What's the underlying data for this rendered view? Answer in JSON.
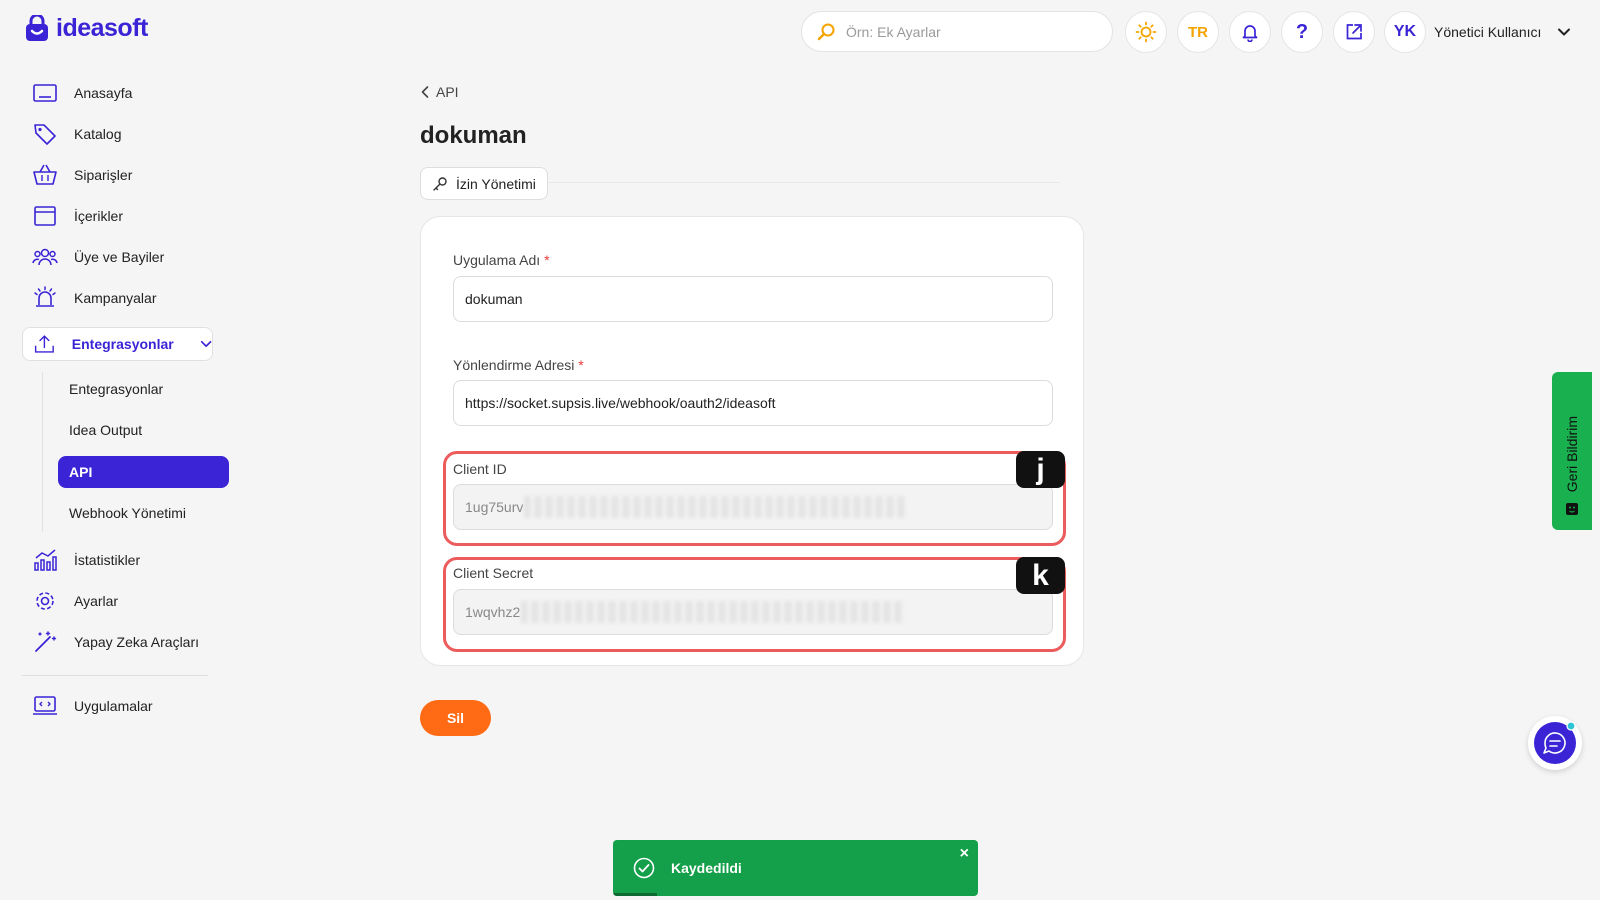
{
  "brand": {
    "name": "ideasoft",
    "color": "#3a24d6"
  },
  "header": {
    "search_placeholder": "Örn: Ek Ayarlar",
    "language": "TR",
    "help_label": "?",
    "user_initials": "YK",
    "user_name": "Yönetici Kullanıcı"
  },
  "sidebar": {
    "items": [
      {
        "label": "Anasayfa",
        "icon": "home-icon"
      },
      {
        "label": "Katalog",
        "icon": "tag-icon"
      },
      {
        "label": "Siparişler",
        "icon": "basket-icon"
      },
      {
        "label": "İçerikler",
        "icon": "window-icon"
      },
      {
        "label": "Üye ve Bayiler",
        "icon": "users-icon"
      },
      {
        "label": "Kampanyalar",
        "icon": "siren-icon"
      },
      {
        "label": "Entegrasyonlar",
        "icon": "upload-icon"
      },
      {
        "label": "İstatistikler",
        "icon": "stats-icon"
      },
      {
        "label": "Ayarlar",
        "icon": "gear-icon"
      },
      {
        "label": "Yapay Zeka Araçları",
        "icon": "magic-wand-icon"
      },
      {
        "label": "Uygulamalar",
        "icon": "app-icon"
      }
    ],
    "sub_items": [
      {
        "label": "Entegrasyonlar"
      },
      {
        "label": "Idea Output"
      },
      {
        "label": "API"
      },
      {
        "label": "Webhook Yönetimi"
      }
    ]
  },
  "main": {
    "breadcrumb": "API",
    "title": "dokuman",
    "permission_button": "İzin Yönetimi",
    "fields": {
      "app_name": {
        "label": "Uygulama Adı",
        "required": "*",
        "value": "dokuman"
      },
      "redirect": {
        "label": "Yönlendirme Adresi",
        "required": "*",
        "value": "https://socket.supsis.live/webhook/oauth2/ideasoft"
      },
      "client_id": {
        "label": "Client ID",
        "value": "1ug75urv"
      },
      "client_secret": {
        "label": "Client Secret",
        "value": "1wqvhz2"
      }
    },
    "annotations": {
      "client_id_tag": "j",
      "client_secret_tag": "k"
    },
    "delete_button": "Sil"
  },
  "feedback_tab": {
    "label": "Geri Bildirim"
  },
  "toast": {
    "message": "Kaydedildi",
    "close": "×",
    "progress": 0.12
  },
  "colors": {
    "accent": "#3a24d6",
    "danger_button": "#ff6a14",
    "success": "#14a04a",
    "highlight": "#ec5c5c",
    "feedback": "#19b14f"
  }
}
